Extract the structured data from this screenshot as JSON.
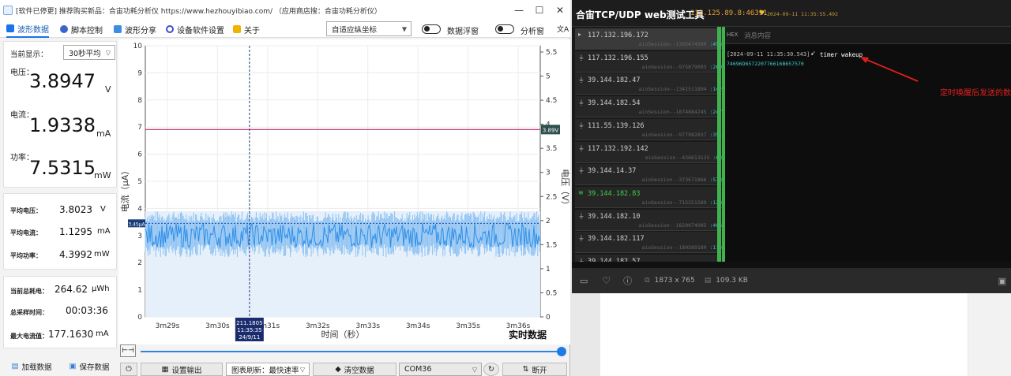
{
  "app": {
    "title": "[软件已停更] 推荐购买新品：合宙功耗分析仪 https://www.hezhouyibiao.com/ （应用商店搜：合宙功耗分析仪）",
    "window_controls": [
      "—",
      "☐",
      "✕"
    ]
  },
  "menu": {
    "items": [
      "波形数据",
      "脚本控制",
      "波形分享",
      "设备软件设置",
      "关于"
    ],
    "axis_mode": "自适应纵坐标",
    "float_label": "数据浮窗",
    "analysis_label": "分析窗",
    "lang_icon": "文A"
  },
  "left": {
    "display_label": "当前显示：",
    "display_value": "30秒平均",
    "voltage": {
      "label": "电压：",
      "value": "3.8947",
      "unit": "V"
    },
    "current": {
      "label": "电流：",
      "value": "1.9338",
      "unit": "mA"
    },
    "power": {
      "label": "功率：",
      "value": "7.5315",
      "unit": "mW"
    },
    "averages": [
      {
        "label": "平均电压：",
        "value": "3.8023",
        "unit": "V"
      },
      {
        "label": "平均电流：",
        "value": "1.1295",
        "unit": "mA"
      },
      {
        "label": "平均功率：",
        "value": "4.3992",
        "unit": "mW"
      }
    ],
    "totals": [
      {
        "label": "当前总耗电：",
        "value": "264.62",
        "unit": "μWh"
      },
      {
        "label": "总采样时间：",
        "value": "00:03:36",
        "unit": ""
      },
      {
        "label": "最大电流值：",
        "value": "177.1630",
        "unit": "mA"
      }
    ],
    "load_btn": "加载数据",
    "save_btn": "保存数据"
  },
  "bottom": {
    "settings_btn": "设置输出",
    "refresh_label": "图表刷新：最快速率",
    "clear_btn": "清空数据",
    "port": "COM36",
    "disconnect_btn": "断开"
  },
  "chart_data": {
    "type": "line",
    "left_axis": {
      "label": "电流（μA）",
      "ticks": [
        0,
        1,
        2,
        3,
        4,
        5,
        6,
        7,
        8,
        9,
        10
      ]
    },
    "right_axis": {
      "label": "电压（V）",
      "ticks": [
        0,
        0.5,
        1,
        1.5,
        2,
        2.5,
        3,
        3.5,
        4,
        4.5,
        5,
        5.5
      ]
    },
    "x_axis": {
      "label": "时间（秒）",
      "ticks": [
        "3m29s",
        "3m30s",
        "3m31s",
        "3m32s",
        "3m33s",
        "3m34s",
        "3m35s",
        "3m36s"
      ]
    },
    "voltage_line": {
      "value": 3.89,
      "label": "3.89V",
      "color": "#c8407a"
    },
    "current_marker": {
      "value": 3.45,
      "label": "3.45μA"
    },
    "current_band": {
      "min": 2.2,
      "max": 3.9,
      "mean": 3.0,
      "color": "#2f8fe8"
    },
    "cursor": {
      "at": "3m31s",
      "label": [
        "211.1805",
        "11:35:35",
        "24/9/11"
      ]
    },
    "badge": "实时数据"
  },
  "web": {
    "title": "合宙TCP/UDP web测试工具",
    "addr": "112.125.89.8:46391",
    "time": "2024-09-11 11:35:55.492",
    "tab_hex": "HEX",
    "placeholder": "消息内容",
    "sessions": [
      {
        "ip": "117.132.196.172",
        "sub": "aioSession--1305474500",
        "port": ":45332",
        "state": "active"
      },
      {
        "ip": "117.132.196.155",
        "sub": "aioSession--975879093",
        "port": ":26957",
        "state": "normal"
      },
      {
        "ip": "39.144.182.47",
        "sub": "aioSession--1341511894",
        "port": ":14266",
        "state": "normal"
      },
      {
        "ip": "39.144.182.54",
        "sub": "aioSession--1874884245",
        "port": ":24761",
        "state": "normal"
      },
      {
        "ip": "111.55.139.126",
        "sub": "aioSession--977982837",
        "port": ":35169",
        "state": "normal"
      },
      {
        "ip": "117.132.192.142",
        "sub": "aioSession--436613135",
        "port": ":6847",
        "state": "normal"
      },
      {
        "ip": "39.144.14.37",
        "sub": "aioSession--373671866",
        "port": ":57818",
        "state": "normal"
      },
      {
        "ip": "39.144.182.83",
        "sub": "aioSession--715251589",
        "port": ":12828",
        "state": "wifi"
      },
      {
        "ip": "39.144.182.10",
        "sub": "aioSession--1820074005",
        "port": ":40667",
        "state": "normal"
      },
      {
        "ip": "39.144.182.117",
        "sub": "aioSession--180589180",
        "port": ":11300",
        "state": "normal"
      },
      {
        "ip": "39.144.182.57",
        "sub": "",
        "port": "",
        "state": "normal"
      }
    ],
    "log_time": "[2024-09-11 11:35:30.543]",
    "log_msg": "timer wakeup",
    "log_hex": "74696D657220776616B657570",
    "annotation": "定时唤醒后发送的数"
  },
  "viewer": {
    "dims": "1873 x 765",
    "size": "109.3 KB"
  }
}
